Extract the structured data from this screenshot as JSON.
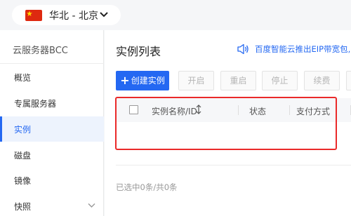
{
  "region": {
    "label": "华北 - 北京",
    "flag_color": "#de2910"
  },
  "sidebar": {
    "title": "云服务器BCC",
    "items": [
      {
        "label": "概览",
        "active": false
      },
      {
        "label": "专属服务器",
        "active": false
      },
      {
        "label": "实例",
        "active": true
      },
      {
        "label": "磁盘",
        "active": false
      },
      {
        "label": "镜像",
        "active": false
      },
      {
        "label": "快照",
        "active": false,
        "expandable": true
      }
    ]
  },
  "main": {
    "title": "实例列表",
    "notice": "百度智能云推出EIP带宽包,",
    "toolbar": {
      "create_label": "创建实例",
      "start_label": "开启",
      "restart_label": "重启",
      "stop_label": "停止",
      "renew_label": "续费"
    },
    "table": {
      "columns": [
        "实例名称/ID",
        "状态",
        "支付方式"
      ]
    },
    "footer": "已选中0条/共0条"
  },
  "colors": {
    "accent": "#2468f2",
    "highlight": "#ea2a2a"
  }
}
